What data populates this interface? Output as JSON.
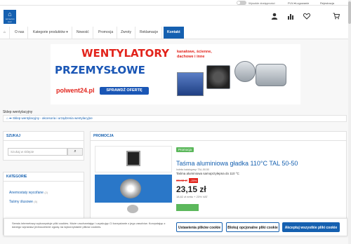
{
  "topbar": {
    "accessibility_label": "Wysokie dostępności",
    "language": "PLN ▾",
    "login": "Logowanie",
    "register": "Rejestracja"
  },
  "header": {
    "logo_text": "VENTILATION SHOP",
    "icons": [
      "user-icon",
      "bar-chart-icon",
      "heart-icon",
      "cart-icon"
    ]
  },
  "nav": {
    "items": [
      {
        "label": "⌂",
        "icon": "home-icon",
        "active": false
      },
      {
        "label": "O nas",
        "active": false
      },
      {
        "label": "Kategorie produktów ▾",
        "active": false
      },
      {
        "label": "Nowość",
        "active": false
      },
      {
        "label": "Promocja",
        "active": false
      },
      {
        "label": "Zwroty",
        "active": false
      },
      {
        "label": "Reklamacje",
        "active": false
      },
      {
        "label": "Kontakt",
        "active": true
      }
    ]
  },
  "banner": {
    "line1": "WENTYLATORY",
    "line2": "PRZEMYSŁOWE",
    "side_line1": "kanałowe, ścienne,",
    "side_line2": "dachowe i inne",
    "url": "polwent24.pl",
    "cta": "SPRAWDŹ OFERTĘ",
    "colors": {
      "red": "#e2241c",
      "blue": "#1a56b5"
    }
  },
  "breadcrumb": {
    "title": "Sklep wentylacyjny",
    "path": "Sklep wentylacyjny - akcesoria i urządzenia wentylacyjne"
  },
  "search": {
    "title": "SZUKAJ",
    "placeholder": "Szukaj w sklepie",
    "button_icon": "search-icon"
  },
  "categories": {
    "title": "KATEGORIE",
    "items": [
      {
        "label": "Anemostaty wycofane",
        "count": "(2)"
      },
      {
        "label": "Taśmy ślusowe",
        "count": "(5)"
      }
    ]
  },
  "promotion": {
    "title": "PROMOCJA",
    "badge": "Promocja",
    "product_name": "Taśma aluminiowa gładka 110°C TAL 50-50",
    "catalog": "Indeks katalogowy: TAL-50-50",
    "description": "Taśma aluminiowa samoprzylepna do 110 °C",
    "old_price": "30,82 zł",
    "discount": "-25%",
    "price": "23,15 zł",
    "net_price": "18,82 zł netto + 23% VAT"
  },
  "cookie": {
    "text": "Serwis internetowy wykorzystuje pliki cookies. Może uruchamiając i uzyskując Ci korzystanie z jego zasobów. Korzystając z danego wyrażasz jednocześnie zgodę na wykorzystanie plików cookies.",
    "btn_settings": "Ustawienia plików cookie",
    "btn_block": "Blokuj opcjonalne pliki cookie",
    "btn_accept": "Akceptuj wszystkie pliki cookie",
    "accent": "#1560b0"
  }
}
